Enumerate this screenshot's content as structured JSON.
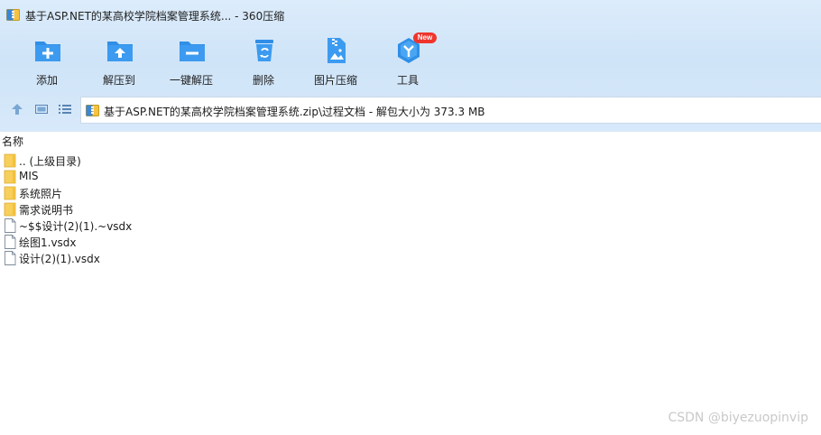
{
  "window": {
    "title": "基于ASP.NET的某高校学院档案管理系统... - 360压缩"
  },
  "toolbar": {
    "items": [
      {
        "label": "添加",
        "icon": "folder-add-icon"
      },
      {
        "label": "解压到",
        "icon": "folder-extract-icon"
      },
      {
        "label": "一键解压",
        "icon": "one-click-extract-icon"
      },
      {
        "label": "删除",
        "icon": "recycle-bin-icon"
      },
      {
        "label": "图片压缩",
        "icon": "image-compress-icon"
      },
      {
        "label": "工具",
        "icon": "tools-icon",
        "badge": "New"
      }
    ]
  },
  "address": {
    "path": "基于ASP.NET的某高校学院档案管理系统.zip\\过程文档 - 解包大小为 373.3 MB"
  },
  "list": {
    "column_name": "名称",
    "items": [
      {
        "name": ".. (上级目录)",
        "type": "folder"
      },
      {
        "name": "MIS",
        "type": "folder"
      },
      {
        "name": "系统照片",
        "type": "folder"
      },
      {
        "name": "需求说明书",
        "type": "folder"
      },
      {
        "name": "~$$设计(2)(1).~vsdx",
        "type": "file"
      },
      {
        "name": "绘图1.vsdx",
        "type": "file"
      },
      {
        "name": "设计(2)(1).vsdx",
        "type": "file"
      }
    ]
  },
  "watermark": "CSDN @biyezuopinvip",
  "colors": {
    "accent_blue": "#2f8fe6",
    "folder_yellow": "#f7cf5a",
    "badge_red": "#f0352d"
  }
}
